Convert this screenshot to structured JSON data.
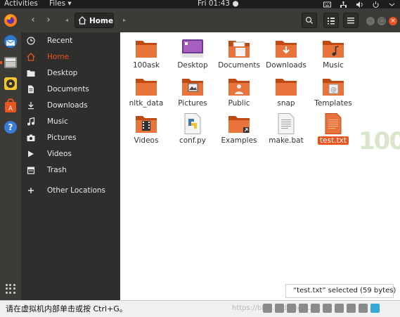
{
  "topbar": {
    "activities": "Activities",
    "app_menu": "Files ▾",
    "clock": "Fri 01:43 ●"
  },
  "header": {
    "path_label": "Home",
    "back_icon": "‹",
    "forward_icon": "›"
  },
  "sidebar": {
    "items": [
      {
        "label": "Recent",
        "icon": "clock-icon"
      },
      {
        "label": "Home",
        "icon": "home-icon"
      },
      {
        "label": "Desktop",
        "icon": "folder-icon"
      },
      {
        "label": "Documents",
        "icon": "document-icon"
      },
      {
        "label": "Downloads",
        "icon": "download-icon"
      },
      {
        "label": "Music",
        "icon": "music-icon"
      },
      {
        "label": "Pictures",
        "icon": "camera-icon"
      },
      {
        "label": "Videos",
        "icon": "video-icon"
      },
      {
        "label": "Trash",
        "icon": "trash-icon"
      },
      {
        "label": "Other Locations",
        "icon": "plus-icon"
      }
    ]
  },
  "files": [
    {
      "name": "100ask",
      "type": "folder"
    },
    {
      "name": "Desktop",
      "type": "folder-desktop"
    },
    {
      "name": "Documents",
      "type": "folder-documents"
    },
    {
      "name": "Downloads",
      "type": "folder-downloads"
    },
    {
      "name": "Music",
      "type": "folder-music"
    },
    {
      "name": "nltk_data",
      "type": "folder"
    },
    {
      "name": "Pictures",
      "type": "folder-pictures"
    },
    {
      "name": "Public",
      "type": "folder-public"
    },
    {
      "name": "snap",
      "type": "folder"
    },
    {
      "name": "Templates",
      "type": "folder-templates"
    },
    {
      "name": "Videos",
      "type": "folder-videos"
    },
    {
      "name": "conf.py",
      "type": "python-file"
    },
    {
      "name": "Examples",
      "type": "folder-link"
    },
    {
      "name": "make.bat",
      "type": "text-file"
    },
    {
      "name": "test.txt",
      "type": "text-file-selected"
    }
  ],
  "status": "“test.txt” selected  (59 bytes)",
  "watermark": "100",
  "bottom": {
    "hint": "请在虚拟机内部单击或按 Ctrl+G。",
    "url": "https://blog.csdn.net/..."
  },
  "colors": {
    "accent": "#e95420",
    "folder": "#e8743b",
    "sidebar_bg": "#2e2e2d",
    "header_bg": "#3c3b37"
  }
}
